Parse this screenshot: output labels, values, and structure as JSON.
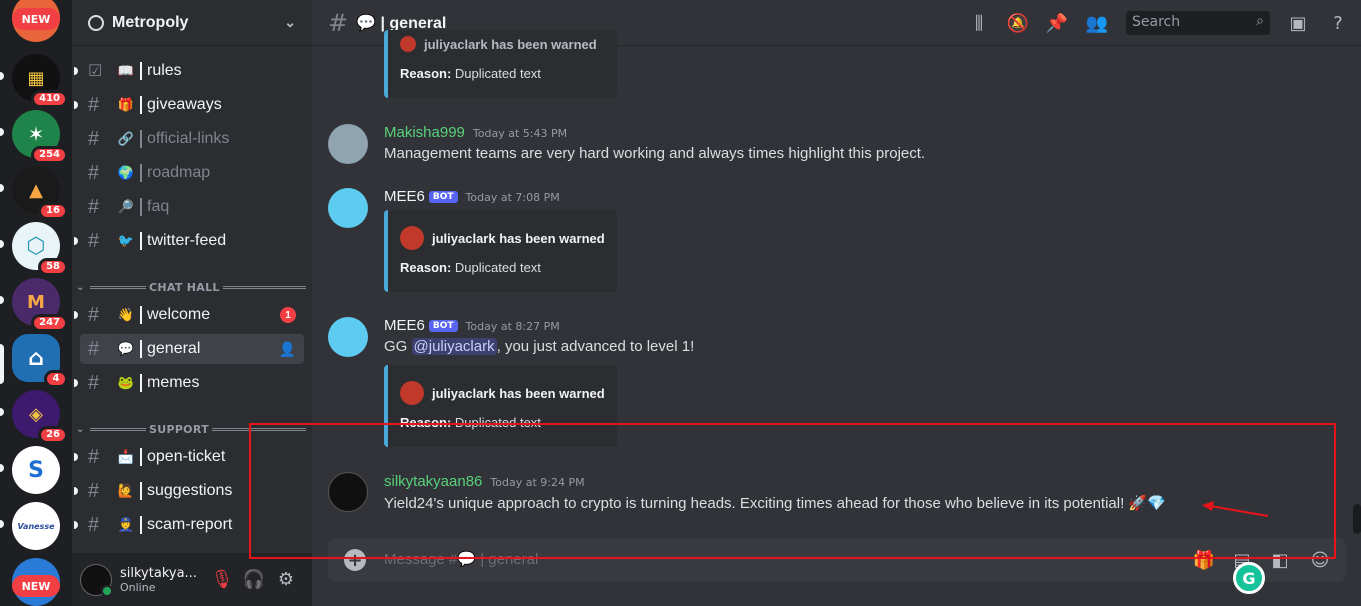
{
  "rail": {
    "top_badge": "NEW",
    "bottom_badge": "NEW",
    "servers": [
      {
        "badge": "410",
        "color": "#111111"
      },
      {
        "badge": "254",
        "color": "#1e8449"
      },
      {
        "badge": "16",
        "color": "#1a1a1a"
      },
      {
        "badge": "58",
        "color": "#e8f4f8"
      },
      {
        "badge": "247",
        "color": "#4a2a6a"
      },
      {
        "badge": "4",
        "color": "#1f6fb2"
      },
      {
        "badge": "26",
        "color": "#3d1a6e"
      },
      {
        "badge": "",
        "color": "#ffffff"
      },
      {
        "badge": "",
        "color": "#ffffff",
        "label": "Vanesse"
      }
    ]
  },
  "guild": {
    "name": "Metropoly"
  },
  "channels": [
    {
      "name": "rules",
      "emoji": "📖",
      "muted": false
    },
    {
      "name": "giveaways",
      "emoji": "🎁",
      "muted": false
    },
    {
      "name": "official-links",
      "emoji": "🔗",
      "muted": true
    },
    {
      "name": "roadmap",
      "emoji": "🌍",
      "muted": true
    },
    {
      "name": "faq",
      "emoji": "🔎",
      "muted": true
    },
    {
      "name": "twitter-feed",
      "emoji": "🐦",
      "muted": false
    }
  ],
  "categories": {
    "chat_hall": "CHAT HALL",
    "support": "SUPPORT"
  },
  "chat_hall_channels": [
    {
      "name": "welcome",
      "emoji": "👋",
      "mentions": "1"
    },
    {
      "name": "general",
      "emoji": "💬",
      "active": true
    },
    {
      "name": "memes",
      "emoji": "🐸"
    }
  ],
  "support_channels": [
    {
      "name": "open-ticket",
      "emoji": "📩"
    },
    {
      "name": "suggestions",
      "emoji": "🙋"
    },
    {
      "name": "scam-report",
      "emoji": "👮"
    }
  ],
  "user": {
    "name": "silkytakya...",
    "status": "Online"
  },
  "header": {
    "channel_title": "💬 | general",
    "search_placeholder": "Search"
  },
  "messages": [
    {
      "embed_partial_warn": "juliyaclark has been warned",
      "reason_label": "Reason:",
      "reason": "Duplicated text"
    },
    {
      "author": "Makisha999",
      "author_color": "#57d17b",
      "time": "Today at 5:43 PM",
      "text": "Management teams are very hard working and always times highlight this project."
    },
    {
      "author": "MEE6",
      "bot": "BOT",
      "time": "Today at 7:08 PM",
      "embed_warn": "juliyaclark has been warned",
      "reason_label": "Reason:",
      "reason": "Duplicated text"
    },
    {
      "author": "MEE6",
      "bot": "BOT",
      "time": "Today at 8:27 PM",
      "text_prefix": "GG ",
      "mention": "@juliyaclark",
      "text_suffix": ", you just advanced to level 1!",
      "embed_warn": "juliyaclark has been warned",
      "reason_label": "Reason:",
      "reason": "Duplicated text"
    },
    {
      "author": "silkytakyaan86",
      "author_color": "#57d17b",
      "time": "Today at 9:24 PM",
      "text": "Yield24's unique approach to crypto is turning heads. Exciting times ahead for those who believe in its potential! 🚀💎"
    }
  ],
  "composer": {
    "placeholder": "Message #💬 | general"
  },
  "colors": {
    "annotation_box": "#e8141a",
    "embed_border": "#4aa9d8",
    "bot_badge": "#5865f2",
    "mee6_avatar": "#5ecbf0"
  }
}
